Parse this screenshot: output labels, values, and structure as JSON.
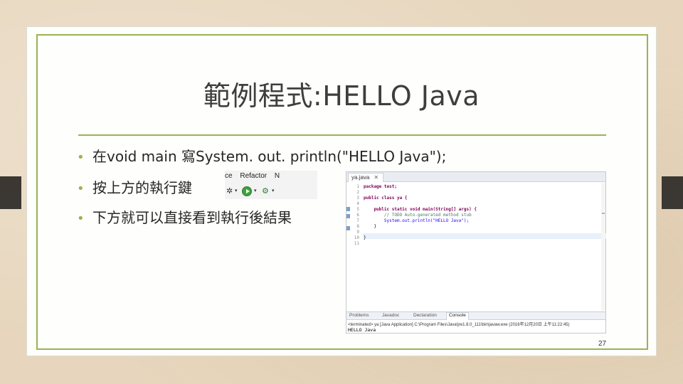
{
  "slide": {
    "title": "範例程式:HELLO Java",
    "bullets": [
      "在void main 寫System. out. println(\"HELLO Java\");",
      "按上方的執行鍵",
      "下方就可以直接看到執行後結果"
    ],
    "page_number": "27"
  },
  "toolbar": {
    "menu_items": [
      "ce",
      "Refactor",
      "N"
    ]
  },
  "ide": {
    "editor_tab": "ya.java",
    "line_numbers": [
      "1",
      "2",
      "3",
      "4",
      "5",
      "6",
      "7",
      "8",
      "9",
      "10",
      "11"
    ],
    "code_lines": [
      "package test;",
      "",
      "public class ya {",
      "",
      "    public static void main(String[] args) {",
      "        // TODO Auto-generated method stub",
      "        System.out.println(\"HELLO Java\");",
      "    }",
      "",
      "}",
      ""
    ],
    "panel_tabs": [
      "Problems",
      "Javadoc",
      "Declaration",
      "Console"
    ],
    "active_panel": "Console",
    "console_status": "<terminated> ya [Java Application] C:\\Program Files\\Java\\jre1.8.0_111\\bin\\javaw.exe (2016年12月20日 上午11:22:45)",
    "console_output": "HELLO Java"
  },
  "colors": {
    "accent": "#99b253",
    "background": "#e7d6bd",
    "slide": "#fefefc",
    "text": "#262626"
  }
}
